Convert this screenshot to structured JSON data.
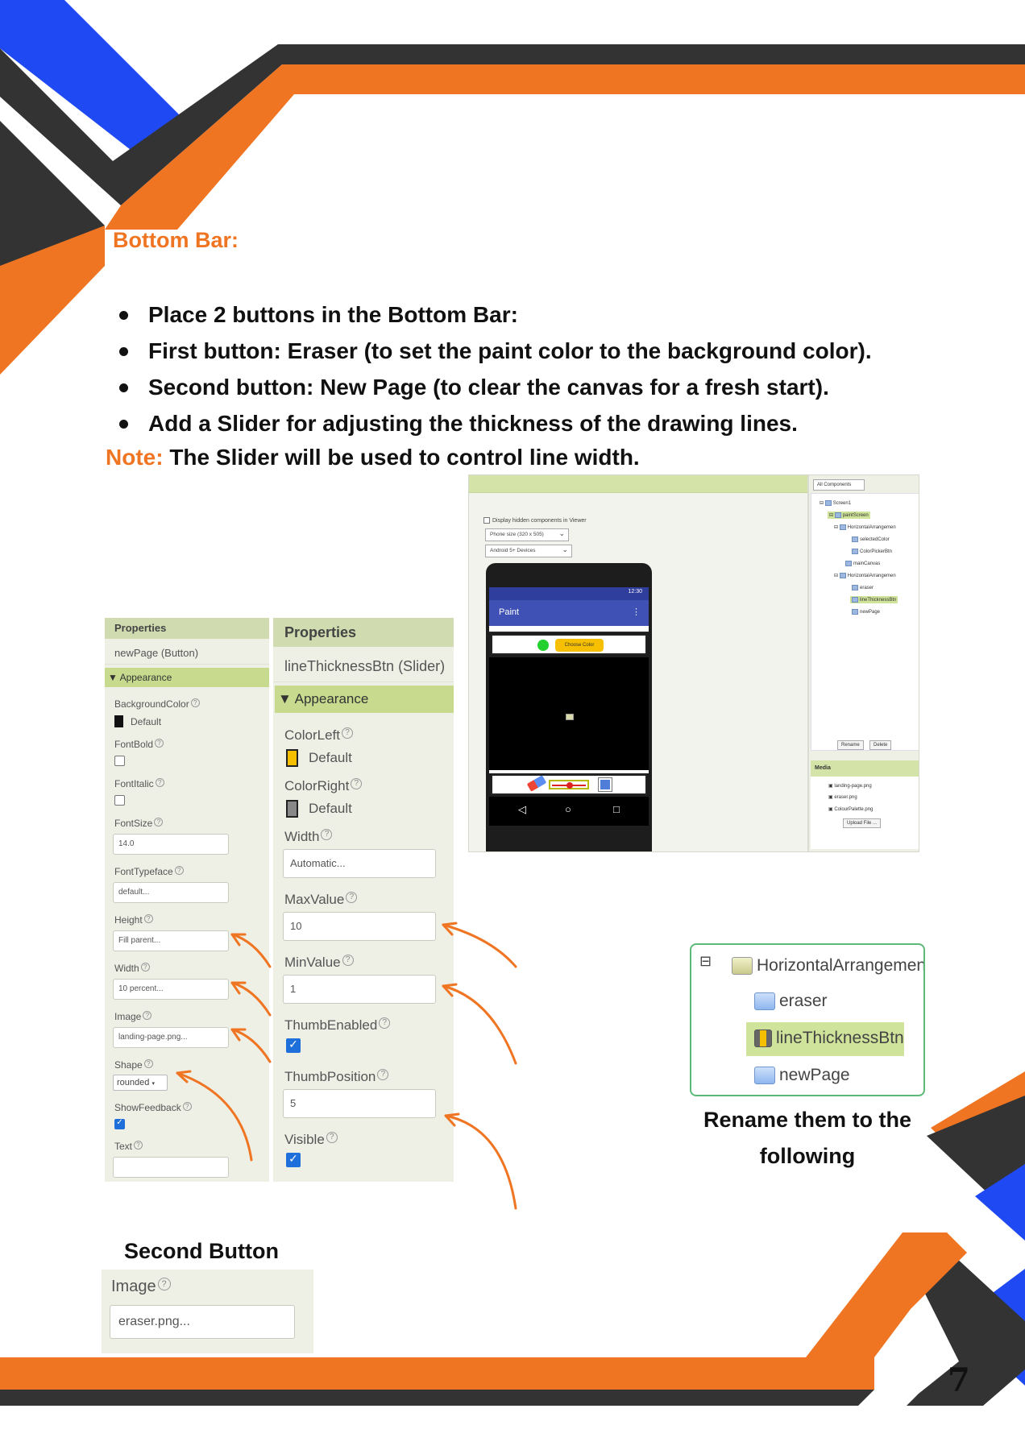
{
  "heading": "Bottom Bar:",
  "bullets": [
    "Place 2 buttons in the Bottom Bar:",
    "First button: Eraser (to set the paint color to the background color).",
    "Second button: New Page (to clear the canvas for a fresh start).",
    "Add a Slider for adjusting the thickness of the drawing lines."
  ],
  "note": {
    "label": "Note:",
    "text": "The Slider will be used to control line width."
  },
  "designer": {
    "checkbox_label": "Display hidden components in Viewer",
    "phone_size": "Phone size (320 x 505)",
    "device": "Android 5+ Devices",
    "status_time": "12:30",
    "app_title": "Paint",
    "menu_glyph": "⋮",
    "choose_color": "Choose Color",
    "nav_back": "◁",
    "nav_home": "○",
    "nav_recent": "□",
    "components_dropdown": "All Components",
    "tree": {
      "screen1": "Screen1",
      "paintscreen": "paintScreen",
      "horiz1": "HorizontalArrangemen",
      "selectedcolor": "selectedColor",
      "colorpicker": "ColorPickerBtn",
      "maincanvas": "mainCanvas",
      "horiz2": "HorizontalArrangemen",
      "eraser": "eraser",
      "linethickness": "lineThicknessBtn",
      "newpage": "newPage"
    },
    "rename_btn": "Rename",
    "delete_btn": "Delete",
    "media_header": "Media",
    "media_files": [
      "landing-page.png",
      "eraser.png",
      "ColourPalette.png"
    ],
    "upload_btn": "Upload File ..."
  },
  "button_props": {
    "header": "Properties",
    "component": "newPage (Button)",
    "section": "Appearance",
    "bgcolor_label": "BackgroundColor",
    "bgcolor_value": "Default",
    "fontbold_label": "FontBold",
    "fontitalic_label": "FontItalic",
    "fontsize_label": "FontSize",
    "fontsize_value": "14.0",
    "fonttypeface_label": "FontTypeface",
    "fonttypeface_value": "default...",
    "height_label": "Height",
    "height_value": "Fill parent...",
    "width_label": "Width",
    "width_value": "10 percent...",
    "image_label": "Image",
    "image_value": "landing-page.png...",
    "shape_label": "Shape",
    "shape_value": "rounded",
    "showfeedback_label": "ShowFeedback",
    "text_label": "Text"
  },
  "slider_props": {
    "header": "Properties",
    "component": "lineThicknessBtn (Slider)",
    "section": "Appearance",
    "colorleft_label": "ColorLeft",
    "colorleft_value": "Default",
    "colorright_label": "ColorRight",
    "colorright_value": "Default",
    "width_label": "Width",
    "width_value": "Automatic...",
    "maxvalue_label": "MaxValue",
    "maxvalue_value": "10",
    "minvalue_label": "MinValue",
    "minvalue_value": "1",
    "thumbenabled_label": "ThumbEnabled",
    "thumbposition_label": "ThumbPosition",
    "thumbposition_value": "5",
    "visible_label": "Visible"
  },
  "rename_box": {
    "parent": "HorizontalArrangemen",
    "items": [
      "eraser",
      "lineThicknessBtn",
      "newPage"
    ],
    "collapse_glyph": "⊟"
  },
  "rename_caption": "Rename them to the following",
  "second_button": {
    "title": "Second Button",
    "label": "Image",
    "value": "eraser.png..."
  },
  "help_glyph": "?",
  "page_number": "7",
  "colors": {
    "orange": "#f07522",
    "blue": "#1f49f2",
    "dark": "#333333",
    "panel_green": "#c7da8e"
  }
}
